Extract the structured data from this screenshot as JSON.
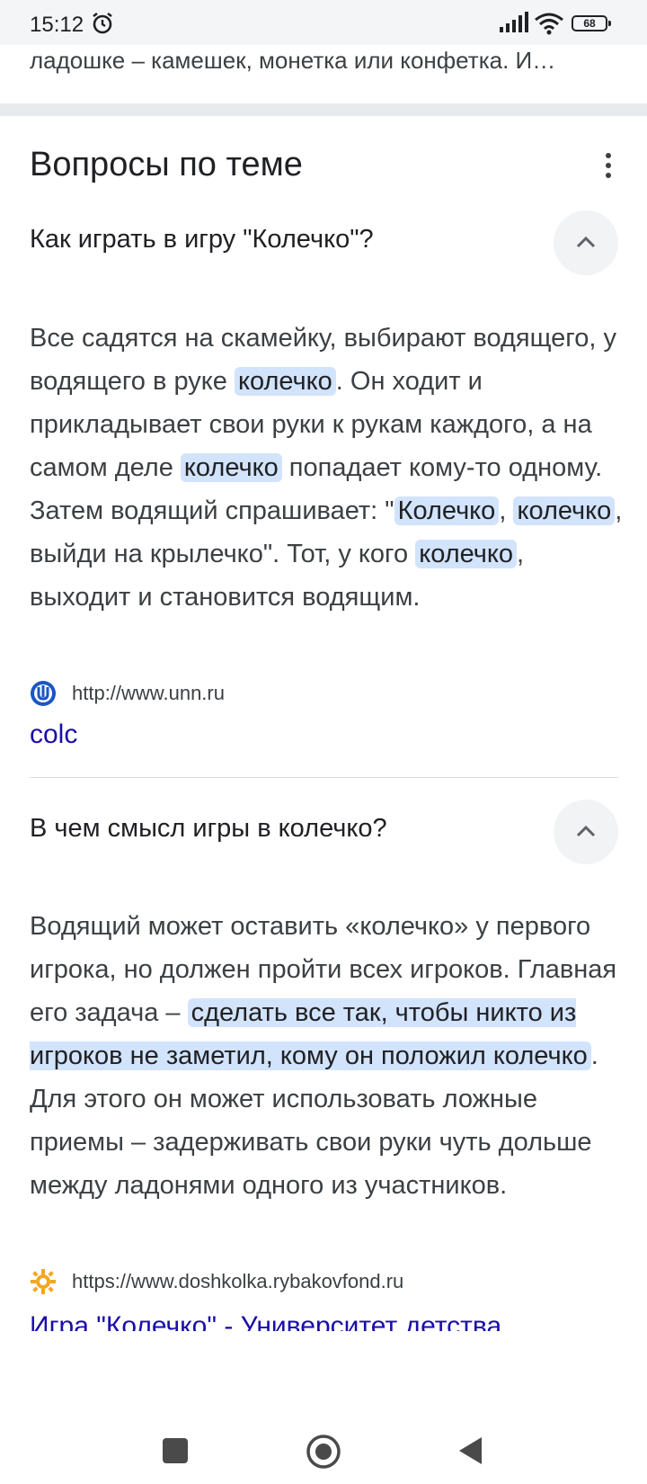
{
  "status": {
    "time": "15:12",
    "battery": "68"
  },
  "prev_snippet": "ладошке – камешек, монетка или конфетка. И…",
  "section": {
    "title": "Вопросы по теме"
  },
  "questions": [
    {
      "title": "Как играть в игру \"Колечко\"?",
      "answer": [
        {
          "t": "Все садятся на скамейку, выбирают водящего, у водящего в руке ",
          "h": false
        },
        {
          "t": "колечко",
          "h": true
        },
        {
          "t": ". Он ходит и прикладывает свои руки к рукам каждого, а на самом деле ",
          "h": false
        },
        {
          "t": "колечко",
          "h": true
        },
        {
          "t": " попадает кому-то одному. Затем водящий спрашивает: \"",
          "h": false
        },
        {
          "t": "Колечко",
          "h": true
        },
        {
          "t": ", ",
          "h": false
        },
        {
          "t": "колечко",
          "h": true
        },
        {
          "t": ", выйди на крылечко\". Тот, у кого ",
          "h": false
        },
        {
          "t": "колечко",
          "h": true
        },
        {
          "t": ", выходит и становится водящим.",
          "h": false
        }
      ],
      "source_url": "http://www.unn.ru",
      "source_link": "colc"
    },
    {
      "title": "В чем смысл игры в колечко?",
      "answer": [
        {
          "t": "Водящий может оставить «колечко» у первого игрока, но должен пройти всех игроков. Главная его задача – ",
          "h": false
        },
        {
          "t": "сделать все так, чтобы никто из игроков не заметил, кому он положил колечко",
          "h": true
        },
        {
          "t": ". Для этого он может использовать ложные приемы – задерживать свои руки чуть дольше между ладонями одного из участников.",
          "h": false
        }
      ],
      "source_url": "https://www.doshkolka.rybakovfond.ru",
      "source_link": "Игра \"Колечко\" - Университет детства"
    }
  ],
  "colors": {
    "highlight": "#d2e3fc",
    "link": "#1a0dab",
    "text": "#3c4043"
  }
}
